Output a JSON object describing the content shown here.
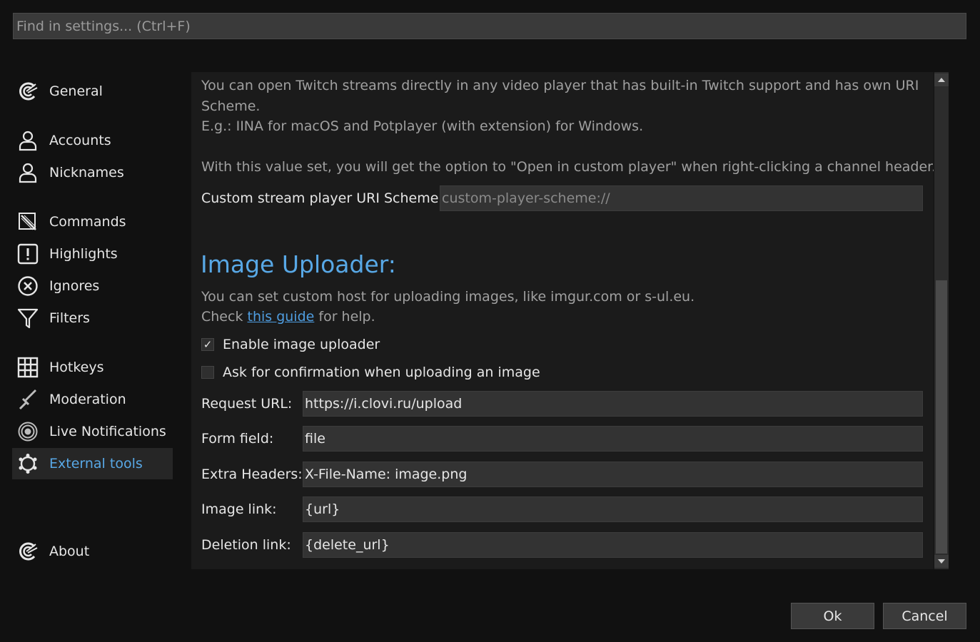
{
  "search": {
    "placeholder": "Find in settings... (Ctrl+F)"
  },
  "sidebar": {
    "items": [
      {
        "label": "General",
        "icon": "chatterino-logo-icon",
        "active": false
      },
      {
        "label": "Accounts",
        "icon": "user-icon",
        "active": false
      },
      {
        "label": "Nicknames",
        "icon": "user-icon",
        "active": false
      },
      {
        "label": "Commands",
        "icon": "commands-icon",
        "active": false
      },
      {
        "label": "Highlights",
        "icon": "exclamation-box-icon",
        "active": false
      },
      {
        "label": "Ignores",
        "icon": "x-circle-icon",
        "active": false
      },
      {
        "label": "Filters",
        "icon": "funnel-icon",
        "active": false
      },
      {
        "label": "Hotkeys",
        "icon": "grid-icon",
        "active": false
      },
      {
        "label": "Moderation",
        "icon": "sword-icon",
        "active": false
      },
      {
        "label": "Live Notifications",
        "icon": "broadcast-icon",
        "active": false
      },
      {
        "label": "External tools",
        "icon": "gear-icon",
        "active": true
      },
      {
        "label": "About",
        "icon": "chatterino-logo-icon",
        "active": false
      }
    ]
  },
  "content": {
    "player_intro_1": "You can open Twitch streams directly in any video player that has built-in Twitch support and has own URI",
    "player_intro_2": "Scheme.",
    "player_intro_3": "E.g.: IINA for macOS and Potplayer (with extension) for Windows.",
    "player_intro_4": "With this value set, you will get the option to \"Open in custom player\" when right-clicking a channel header.",
    "custom_player_label": "Custom stream player URI Scheme:",
    "custom_player_placeholder": "custom-player-scheme://",
    "uploader_heading": "Image Uploader:",
    "uploader_desc": "You can set custom host for uploading images, like imgur.com or s-ul.eu.",
    "uploader_help_prefix": "Check ",
    "uploader_help_link": "this guide",
    "uploader_help_suffix": " for help.",
    "enable_uploader_label": "Enable image uploader",
    "enable_uploader_checked": true,
    "confirm_upload_label": "Ask for confirmation when uploading an image",
    "confirm_upload_checked": false,
    "fields": {
      "request_url_label": "Request URL:",
      "request_url_value": "https://i.clovi.ru/upload",
      "form_field_label": "Form field:",
      "form_field_value": "file",
      "extra_headers_label": "Extra Headers:",
      "extra_headers_value": "X-File-Name: image.png",
      "image_link_label": "Image link:",
      "image_link_value": "{url}",
      "deletion_link_label": "Deletion link:",
      "deletion_link_value": "{delete_url}"
    }
  },
  "buttons": {
    "ok": "Ok",
    "cancel": "Cancel"
  },
  "colors": {
    "accent": "#58a8e6",
    "link": "#4f9de0",
    "background": "#111111",
    "panel": "#1b1b1b"
  }
}
